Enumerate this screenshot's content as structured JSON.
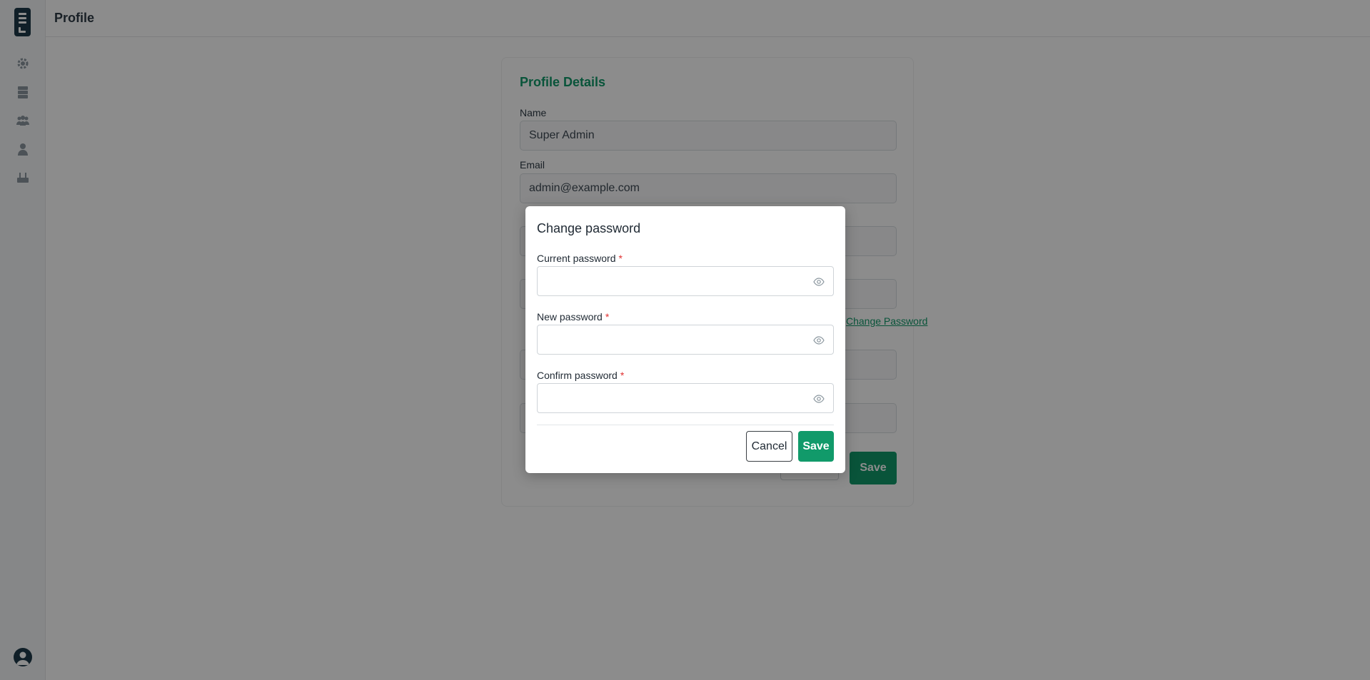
{
  "header": {
    "title": "Profile"
  },
  "sidebar": {
    "items": [
      {
        "icon": "gear-icon"
      },
      {
        "icon": "server-icon"
      },
      {
        "icon": "users-icon"
      },
      {
        "icon": "user-icon"
      },
      {
        "icon": "router-icon"
      }
    ],
    "avatar_icon": "user-avatar-icon"
  },
  "profile": {
    "title": "Profile Details",
    "name_label": "Name",
    "name_value": "Super Admin",
    "email_label": "Email",
    "email_value": "admin@example.com",
    "change_password_link": "Change Password",
    "save_label": "Save"
  },
  "modal": {
    "title": "Change password",
    "fields": [
      {
        "label": "Current password",
        "required": "*"
      },
      {
        "label": "New password",
        "required": "*"
      },
      {
        "label": "Confirm password",
        "required": "*"
      }
    ],
    "cancel_label": "Cancel",
    "save_label": "Save"
  },
  "colors": {
    "accent": "#119a6a",
    "required": "#e03131",
    "sidebar_dark": "#1e3a4a"
  }
}
